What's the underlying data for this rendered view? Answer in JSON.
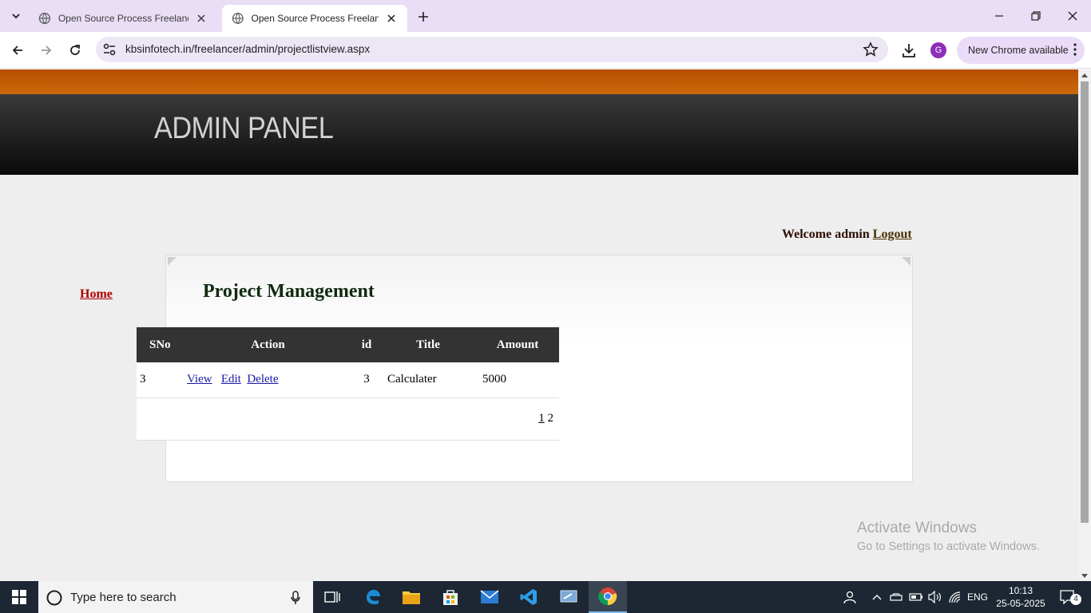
{
  "browser": {
    "tabs": [
      {
        "title": "Open Source Process Freelancer",
        "active": false
      },
      {
        "title": "Open Source Process Freelancer",
        "active": true
      }
    ],
    "url": "kbsinfotech.in/freelancer/admin/projectlistview.aspx",
    "update_label": "New Chrome available",
    "profile_initial": "G"
  },
  "page": {
    "header_title": "ADMIN PANEL",
    "welcome_text": "Welcome admin",
    "logout_label": "Logout",
    "home_label": "Home",
    "panel_title": "Project Management",
    "grid": {
      "headers": [
        "SNo",
        "Action",
        "id",
        "Title",
        "Amount"
      ],
      "rows": [
        {
          "sno": "3",
          "actions": [
            "View",
            "Edit",
            "Delete"
          ],
          "id": "3",
          "title": "Calculater",
          "amount": "5000"
        }
      ],
      "pager": {
        "current": "1",
        "next": "2"
      }
    }
  },
  "watermark": {
    "line1": "Activate Windows",
    "line2": "Go to Settings to activate Windows."
  },
  "taskbar": {
    "search_placeholder": "Type here to search",
    "language": "ENG",
    "time": "10:13",
    "date": "25-05-2025",
    "notification_count": "4"
  },
  "colors": {
    "orange_bar": "#c05a05",
    "header_dark": "#1a1a1a",
    "grid_header": "#333333",
    "home_link": "#b00000",
    "action_link": "#1a1aa6"
  }
}
